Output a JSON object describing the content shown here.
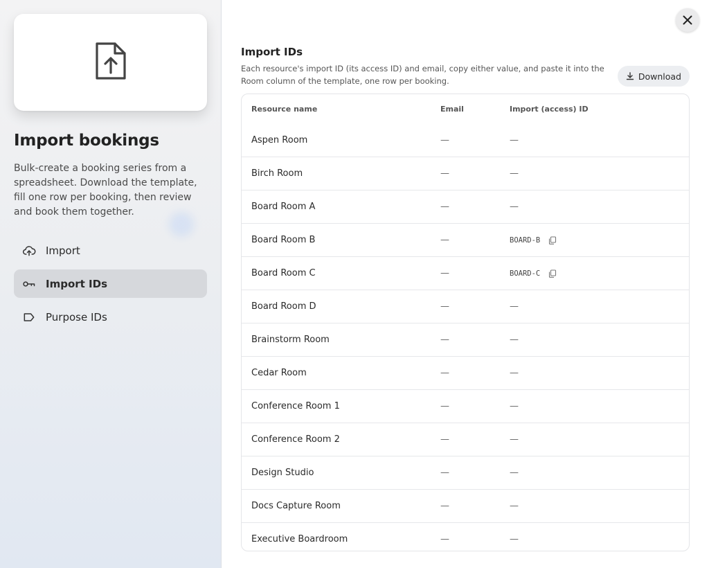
{
  "sidebar": {
    "title": "Import bookings",
    "description": "Bulk-create a booking series from a spreadsheet. Download the template, fill one row per booking, then review and book them together.",
    "nav": [
      {
        "label": "Import",
        "icon": "cloud-upload-icon",
        "active": false
      },
      {
        "label": "Import IDs",
        "icon": "key-icon",
        "active": true
      },
      {
        "label": "Purpose IDs",
        "icon": "tag-icon",
        "active": false
      }
    ]
  },
  "main": {
    "section_title": "Import IDs",
    "section_description": "Each resource's import ID (its access ID) and email, copy either value, and paste it into the Room column of the template, one row per booking.",
    "download_label": "Download",
    "columns": [
      "Resource name",
      "Email",
      "Import (access) ID"
    ],
    "rows": [
      {
        "name": "Aspen Room",
        "email": "—",
        "id": "—",
        "copyable": false
      },
      {
        "name": "Birch Room",
        "email": "—",
        "id": "—",
        "copyable": false
      },
      {
        "name": "Board Room A",
        "email": "—",
        "id": "—",
        "copyable": false
      },
      {
        "name": "Board Room B",
        "email": "—",
        "id": "BOARD-B",
        "copyable": true
      },
      {
        "name": "Board Room C",
        "email": "—",
        "id": "BOARD-C",
        "copyable": true
      },
      {
        "name": "Board Room D",
        "email": "—",
        "id": "—",
        "copyable": false
      },
      {
        "name": "Brainstorm Room",
        "email": "—",
        "id": "—",
        "copyable": false
      },
      {
        "name": "Cedar Room",
        "email": "—",
        "id": "—",
        "copyable": false
      },
      {
        "name": "Conference Room 1",
        "email": "—",
        "id": "—",
        "copyable": false
      },
      {
        "name": "Conference Room 2",
        "email": "—",
        "id": "—",
        "copyable": false
      },
      {
        "name": "Design Studio",
        "email": "—",
        "id": "—",
        "copyable": false
      },
      {
        "name": "Docs Capture Room",
        "email": "—",
        "id": "—",
        "copyable": false
      },
      {
        "name": "Executive Boardroom",
        "email": "—",
        "id": "—",
        "copyable": false
      }
    ]
  }
}
